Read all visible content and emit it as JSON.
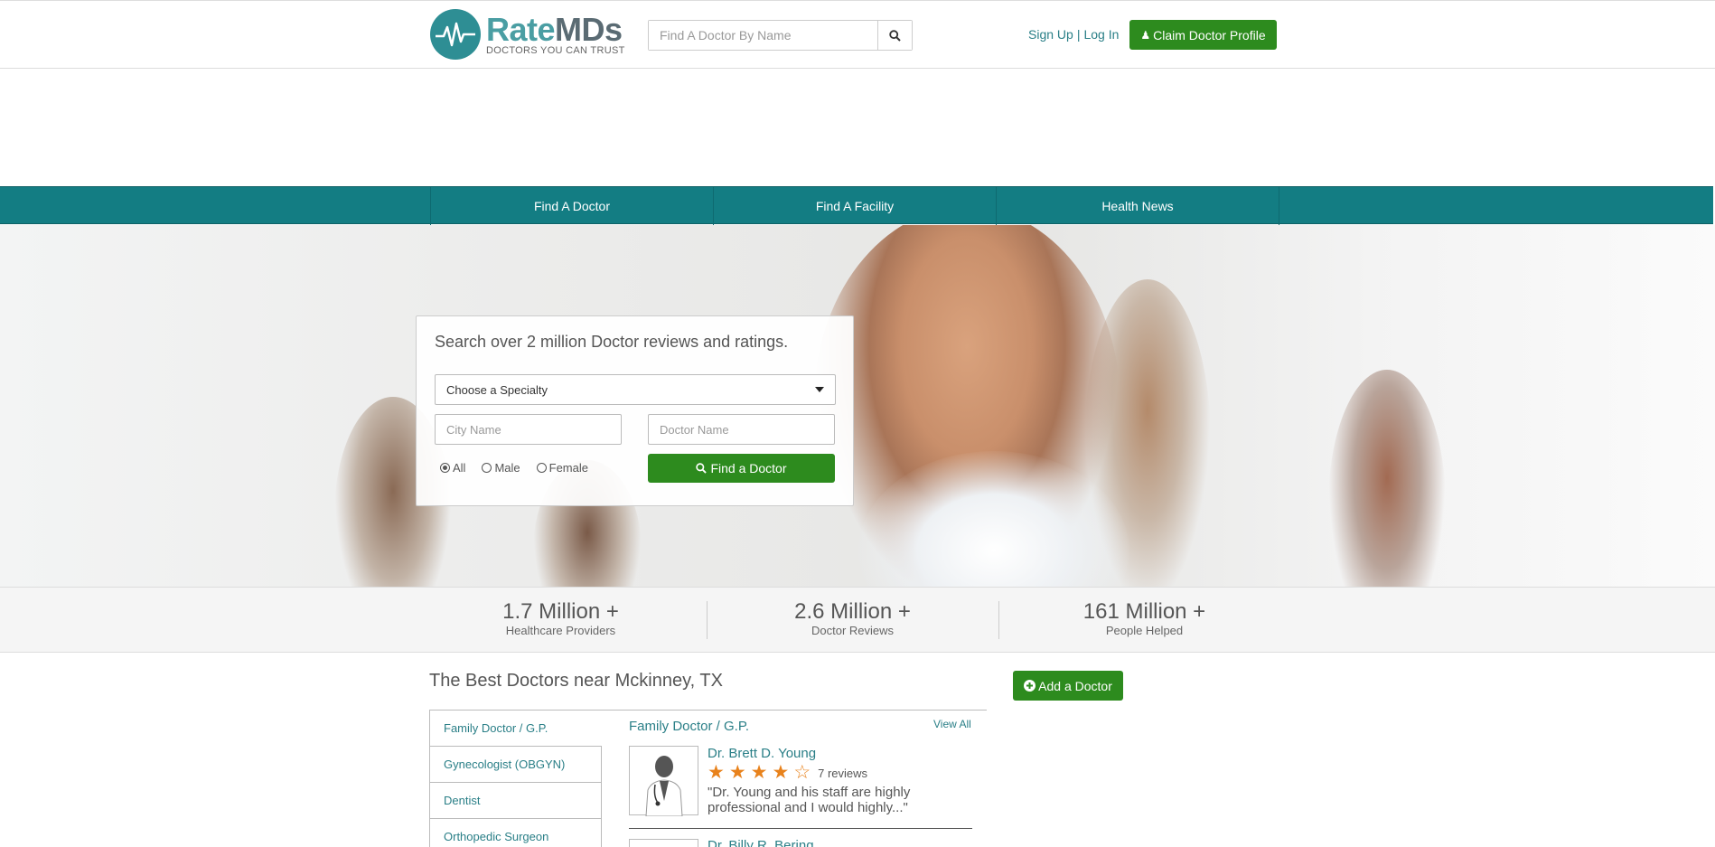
{
  "header": {
    "logo_name_part1": "Rate",
    "logo_name_part2": "MDs",
    "logo_tagline": "DOCTORS YOU CAN TRUST",
    "search_placeholder": "Find A Doctor By Name",
    "sign_up": "Sign Up",
    "separator": "|",
    "log_in": "Log In",
    "claim_button": "Claim Doctor Profile"
  },
  "nav": {
    "items": [
      {
        "label": "Find A Doctor"
      },
      {
        "label": "Find A Facility"
      },
      {
        "label": "Health News"
      }
    ]
  },
  "hero": {
    "title": "Search over 2 million Doctor reviews and ratings.",
    "specialty_select": "Choose a Specialty",
    "city_placeholder": "City Name",
    "doctor_placeholder": "Doctor Name",
    "gender_options": [
      {
        "label": "All",
        "selected": true
      },
      {
        "label": "Male",
        "selected": false
      },
      {
        "label": "Female",
        "selected": false
      }
    ],
    "find_button": "Find a Doctor"
  },
  "stats": [
    {
      "value": "1.7 Million +",
      "label": "Healthcare Providers"
    },
    {
      "value": "2.6 Million +",
      "label": "Doctor Reviews"
    },
    {
      "value": "161 Million +",
      "label": "People Helped"
    }
  ],
  "best": {
    "title": "The Best Doctors near Mckinney, TX",
    "add_button": "Add a Doctor",
    "specialties": [
      {
        "label": "Family Doctor / G.P.",
        "active": true
      },
      {
        "label": "Gynecologist (OBGYN)",
        "active": false
      },
      {
        "label": "Dentist",
        "active": false
      },
      {
        "label": "Orthopedic Surgeon",
        "active": false
      }
    ],
    "panel_title": "Family Doctor / G.P.",
    "view_all": "View All",
    "doctors": [
      {
        "name": "Dr. Brett D. Young",
        "rating": 4,
        "max_rating": 5,
        "reviews": "7 reviews",
        "quote": "\"Dr. Young and his staff are highly professional and I would highly...\""
      },
      {
        "name": "Dr. Billy R. Bering"
      }
    ]
  },
  "colors": {
    "brand_teal": "#137d83",
    "link_teal": "#2a7f87",
    "button_green": "#2d8b1e",
    "star_orange": "#e8821c"
  },
  "icons": {
    "search": "search-icon",
    "user": "user-md-icon",
    "plus": "plus-circle-icon",
    "dropdown": "caret-down-icon"
  }
}
